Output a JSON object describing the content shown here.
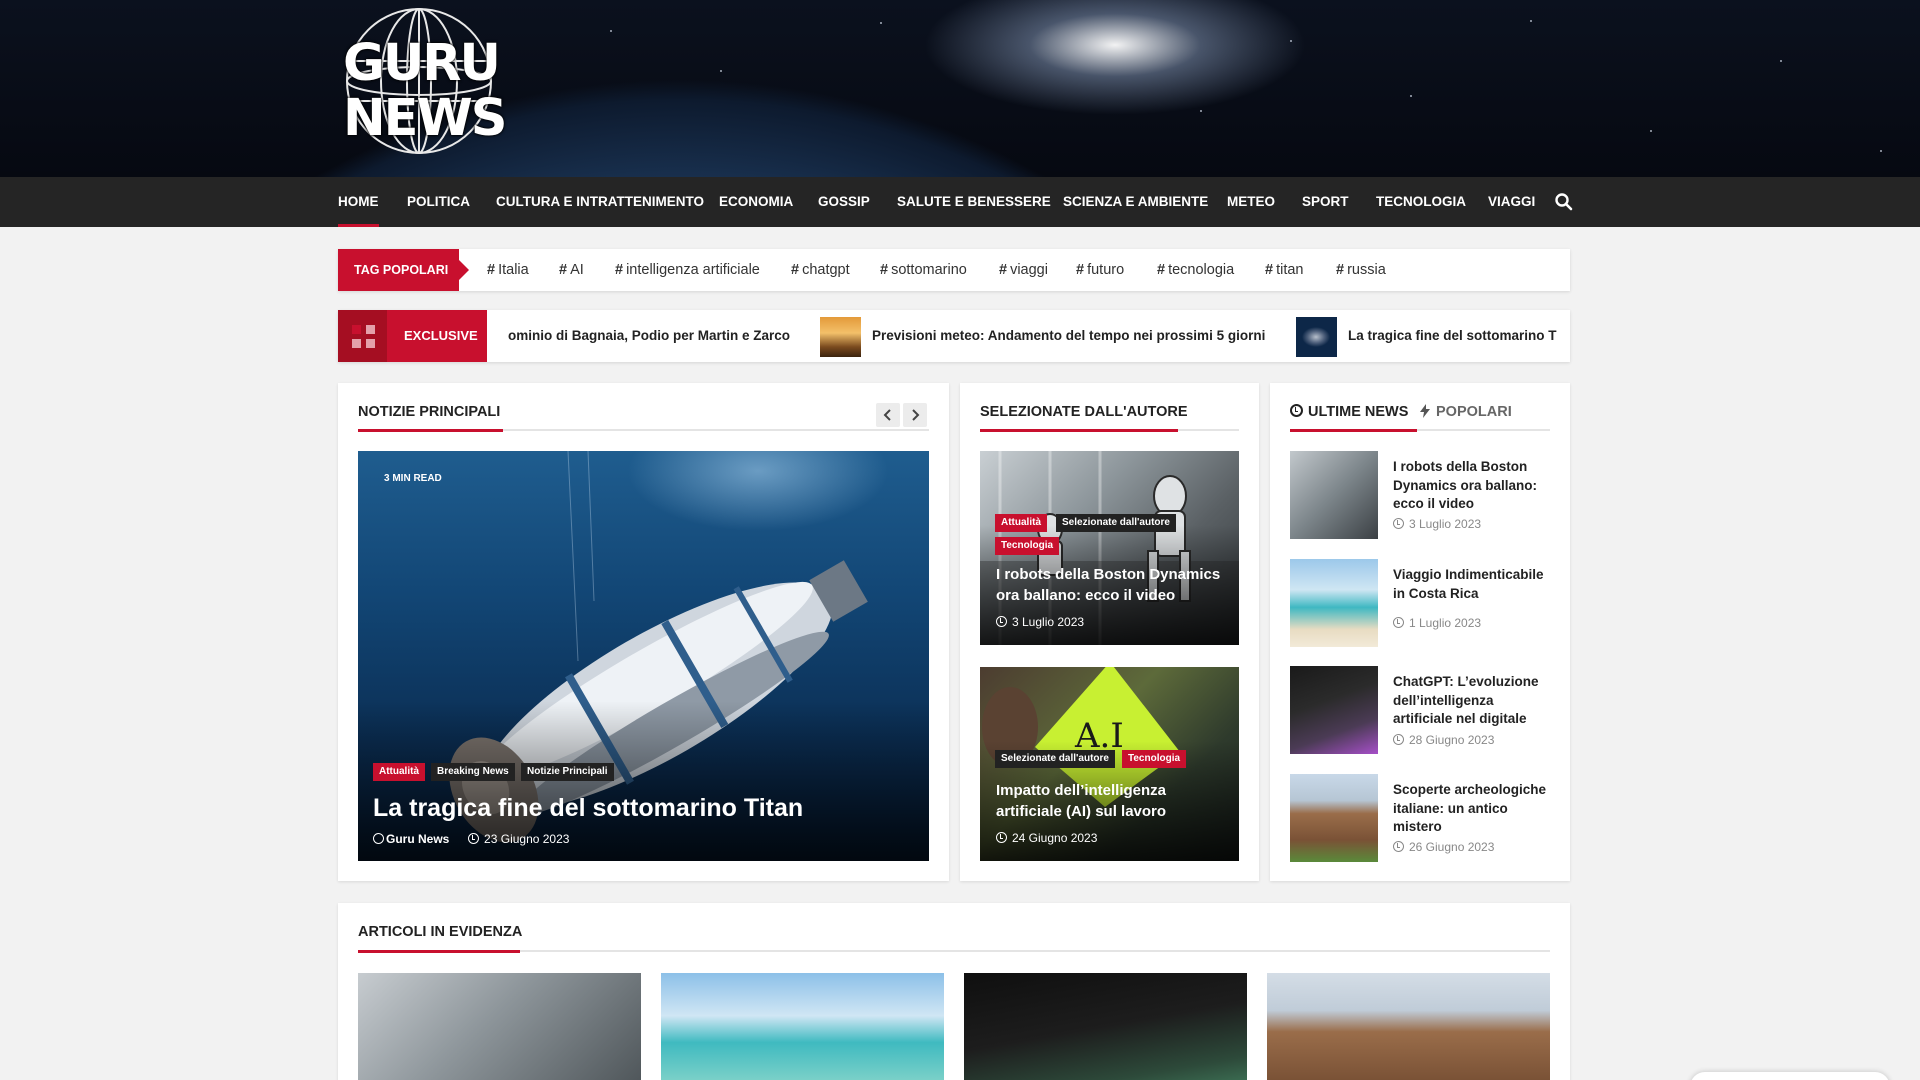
{
  "brand": {
    "logo_line1": "GURU",
    "logo_line2": "NEWS",
    "accent": "#c8102e",
    "nav_bg": "#252525"
  },
  "nav": {
    "items": [
      "Home",
      "Politica",
      "Cultura e intrattenimento",
      "Economia",
      "Gossip",
      "Salute e benessere",
      "Scienza e ambiente",
      "Meteo",
      "Sport",
      "Tecnologia",
      "Viaggi"
    ],
    "active": "Home",
    "search_icon": "search-icon"
  },
  "tags": {
    "label": "TAG POPOLARI",
    "items": [
      "Italia",
      "AI",
      "intelligenza artificiale",
      "chatgpt",
      "sottomarino",
      "viaggi",
      "futuro",
      "tecnologia",
      "titan",
      "russia"
    ]
  },
  "ticker": {
    "label": "EXCLUSIVE",
    "items": [
      "ominio di Bagnaia, Podio per Martin e Zarco",
      "Previsioni meteo: Andamento del tempo nei prossimi 5 giorni",
      "La tragica fine del sottomarino T"
    ]
  },
  "main": {
    "section_title": "NOTIZIE PRINCIPALI",
    "read_time": "3 MIN READ",
    "categories": [
      "Attualità",
      "Breaking News",
      "Notizie Principali"
    ],
    "title": "La tragica fine del sottomarino Titan",
    "author": "Guru News",
    "date": "23 Giugno 2023"
  },
  "editor": {
    "section_title": "SELEZIONATE DALL'AUTORE",
    "cards": [
      {
        "categories": [
          "Attualità",
          "Selezionate dall'autore",
          "Tecnologia"
        ],
        "title": "I robots della Boston Dynamics ora ballano: ecco il video",
        "date": "3 Luglio 2023"
      },
      {
        "categories": [
          "Selezionate dall'autore",
          "Tecnologia"
        ],
        "title": "Impatto dell’intelligenza artificiale (AI) sul lavoro",
        "date": "24 Giugno 2023",
        "sign_text": "A.I"
      }
    ]
  },
  "sidebar": {
    "tab_latest": "ULTIME NEWS",
    "tab_popular": "POPOLARI",
    "items": [
      {
        "title": "I robots della Boston Dynamics ora ballano: ecco il video",
        "date": "3 Luglio 2023"
      },
      {
        "title": "Viaggio Indimenticabile in Costa Rica",
        "date": "1 Luglio 2023"
      },
      {
        "title": "ChatGPT: L’evoluzione dell’intelligenza artificiale nel digitale",
        "date": "28 Giugno 2023"
      },
      {
        "title": "Scoperte archeologiche italiane: un antico mistero",
        "date": "26 Giugno 2023"
      }
    ]
  },
  "featured": {
    "section_title": "ARTICOLI IN EVIDENZA"
  }
}
